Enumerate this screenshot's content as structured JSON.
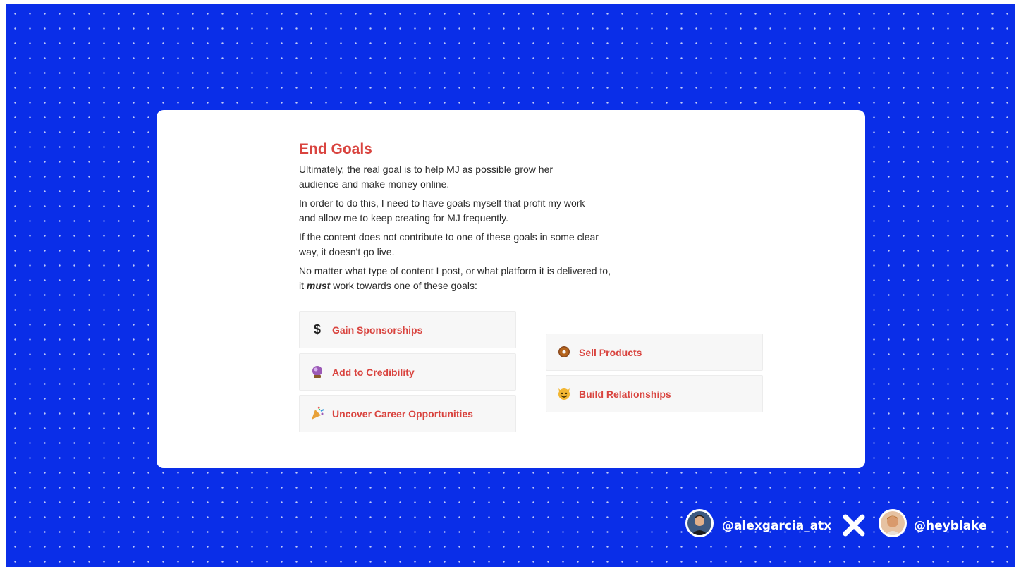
{
  "card": {
    "title": "End Goals",
    "paragraphs": [
      {
        "lines": [
          "Ultimately, the real goal is to help MJ as possible grow her",
          "audience and make money online."
        ]
      },
      {
        "lines": [
          "In order to do this, I need to have goals myself that profit my work",
          "and allow me to keep creating for MJ frequently."
        ]
      },
      {
        "lines": [
          "If the content does not contribute to one of these goals in some clear",
          "way, it doesn't go live."
        ]
      },
      {
        "lines": [
          "No matter what type of content I post, or what platform it is delivered to,"
        ]
      }
    ],
    "last_line": {
      "prefix": "it ",
      "emphasis": "must",
      "suffix": " work towards one of these goals:"
    },
    "goals_left": [
      {
        "icon": "dollar-icon",
        "glyph": "$",
        "label": "Gain Sponsorships"
      },
      {
        "icon": "crystal-ball-icon",
        "glyph": "🔮",
        "label": "Add to Credibility"
      },
      {
        "icon": "party-popper-icon",
        "glyph": "🎉",
        "label": "Uncover Career Opportunities"
      }
    ],
    "goals_right": [
      {
        "icon": "donut-icon",
        "glyph": "🍩",
        "label": "Sell Products"
      },
      {
        "icon": "cat-face-icon",
        "glyph": "😺",
        "label": "Build Relationships"
      }
    ]
  },
  "footer": {
    "handle_left": "@alexgarcia_atx",
    "separator": "✕",
    "handle_right": "@heyblake"
  },
  "colors": {
    "background": "#0a2ee8",
    "accent": "#d9443f",
    "card": "#ffffff"
  }
}
